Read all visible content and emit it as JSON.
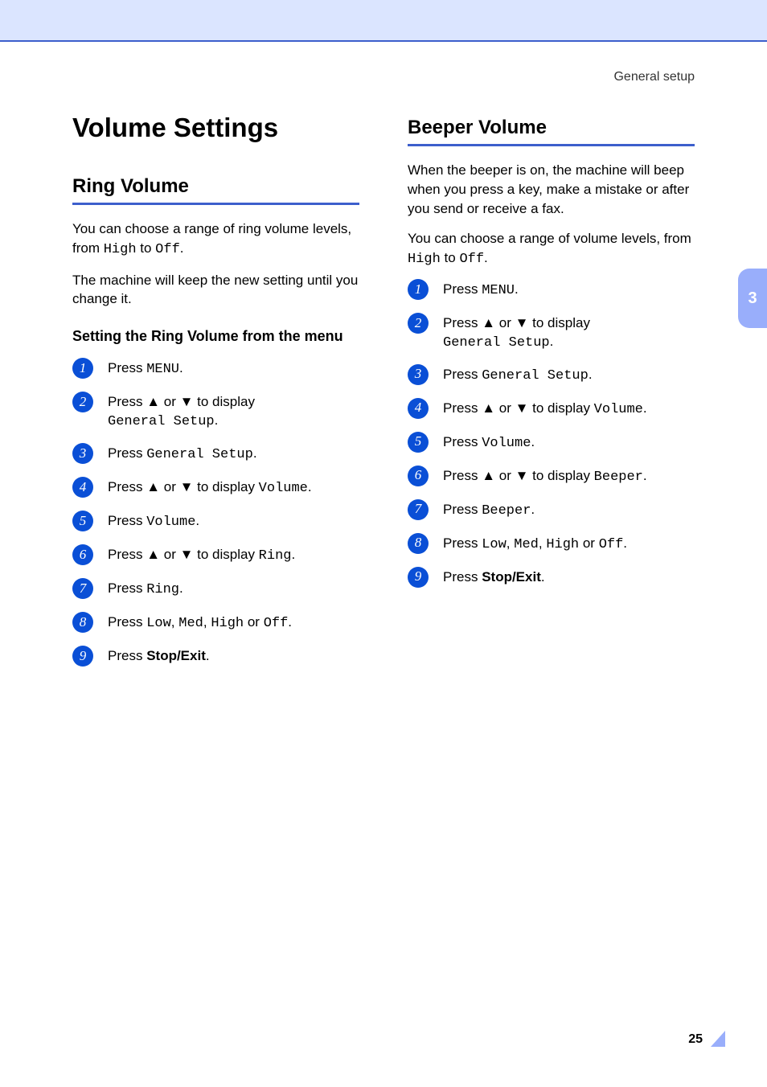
{
  "breadcrumb": "General setup",
  "side_tab": "3",
  "page_number": "25",
  "h1": "Volume Settings",
  "left": {
    "h2": "Ring Volume",
    "p1_pre": "You can choose a range of ring volume levels, from ",
    "p1_code1": "High",
    "p1_mid": " to ",
    "p1_code2": "Off",
    "p1_post": ".",
    "p2": "The machine will keep the new setting until you change it.",
    "h3": "Setting the Ring Volume from the menu",
    "steps": {
      "s1_pre": "Press ",
      "s1_code": "MENU",
      "s1_post": ".",
      "s2_pre": "Press ",
      "s2_up": "▲",
      "s2_mid": " or ",
      "s2_down": "▼",
      "s2_mid2": " to display ",
      "s2_code": "General Setup",
      "s2_post": ".",
      "s3_pre": "Press ",
      "s3_code": "General Setup",
      "s3_post": ".",
      "s4_pre": "Press ",
      "s4_up": "▲",
      "s4_mid": " or ",
      "s4_down": "▼",
      "s4_mid2": " to display ",
      "s4_code": "Volume",
      "s4_post": ".",
      "s5_pre": "Press ",
      "s5_code": "Volume",
      "s5_post": ".",
      "s6_pre": "Press ",
      "s6_up": "▲",
      "s6_mid": " or ",
      "s6_down": "▼",
      "s6_mid2": " to display ",
      "s6_code": "Ring",
      "s6_post": ".",
      "s7_pre": "Press ",
      "s7_code": "Ring",
      "s7_post": ".",
      "s8_pre": "Press ",
      "s8_code1": "Low",
      "s8_c1": ", ",
      "s8_code2": "Med",
      "s8_c2": ", ",
      "s8_code3": "High",
      "s8_c3": " or ",
      "s8_code4": "Off",
      "s8_post": ".",
      "s9_pre": "Press ",
      "s9_bold": "Stop/Exit",
      "s9_post": "."
    }
  },
  "right": {
    "h2": "Beeper Volume",
    "p1": "When the beeper is on, the machine will beep when you press a key, make a mistake or after you send or receive a fax.",
    "p2_pre": "You can choose a range of volume levels, from ",
    "p2_code1": "High",
    "p2_mid": " to ",
    "p2_code2": "Off",
    "p2_post": ".",
    "steps": {
      "s1_pre": "Press ",
      "s1_code": "MENU",
      "s1_post": ".",
      "s2_pre": "Press ",
      "s2_up": "▲",
      "s2_mid": " or ",
      "s2_down": "▼",
      "s2_mid2": " to display ",
      "s2_code": "General Setup",
      "s2_post": ".",
      "s3_pre": "Press ",
      "s3_code": "General Setup",
      "s3_post": ".",
      "s4_pre": "Press ",
      "s4_up": "▲",
      "s4_mid": " or ",
      "s4_down": "▼",
      "s4_mid2": " to display ",
      "s4_code": "Volume",
      "s4_post": ".",
      "s5_pre": "Press ",
      "s5_code": "Volume",
      "s5_post": ".",
      "s6_pre": "Press ",
      "s6_up": "▲",
      "s6_mid": " or ",
      "s6_down": "▼",
      "s6_mid2": " to display ",
      "s6_code": "Beeper",
      "s6_post": ".",
      "s7_pre": "Press ",
      "s7_code": "Beeper",
      "s7_post": ".",
      "s8_pre": "Press ",
      "s8_code1": "Low",
      "s8_c1": ", ",
      "s8_code2": "Med",
      "s8_c2": ", ",
      "s8_code3": "High",
      "s8_c3": " or ",
      "s8_code4": "Off",
      "s8_post": ".",
      "s9_pre": "Press ",
      "s9_bold": "Stop/Exit",
      "s9_post": "."
    }
  }
}
